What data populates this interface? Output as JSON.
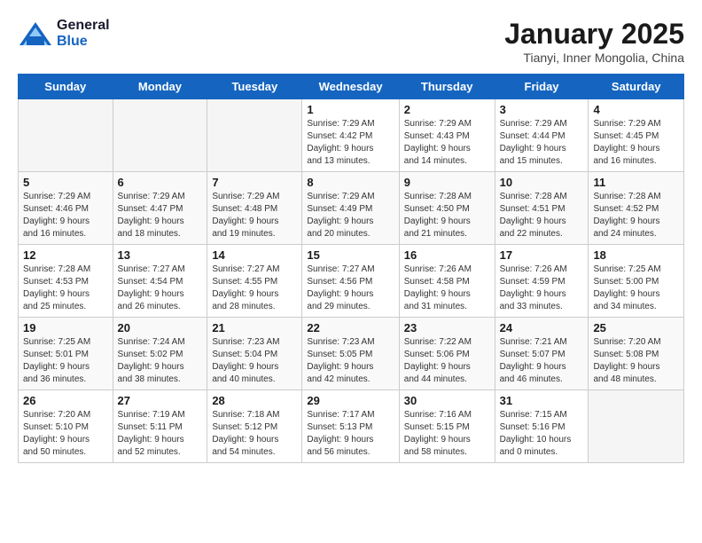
{
  "logo": {
    "general": "General",
    "blue": "Blue"
  },
  "title": "January 2025",
  "location": "Tianyi, Inner Mongolia, China",
  "days_header": [
    "Sunday",
    "Monday",
    "Tuesday",
    "Wednesday",
    "Thursday",
    "Friday",
    "Saturday"
  ],
  "weeks": [
    [
      {
        "day": "",
        "info": ""
      },
      {
        "day": "",
        "info": ""
      },
      {
        "day": "",
        "info": ""
      },
      {
        "day": "1",
        "info": "Sunrise: 7:29 AM\nSunset: 4:42 PM\nDaylight: 9 hours\nand 13 minutes."
      },
      {
        "day": "2",
        "info": "Sunrise: 7:29 AM\nSunset: 4:43 PM\nDaylight: 9 hours\nand 14 minutes."
      },
      {
        "day": "3",
        "info": "Sunrise: 7:29 AM\nSunset: 4:44 PM\nDaylight: 9 hours\nand 15 minutes."
      },
      {
        "day": "4",
        "info": "Sunrise: 7:29 AM\nSunset: 4:45 PM\nDaylight: 9 hours\nand 16 minutes."
      }
    ],
    [
      {
        "day": "5",
        "info": "Sunrise: 7:29 AM\nSunset: 4:46 PM\nDaylight: 9 hours\nand 16 minutes."
      },
      {
        "day": "6",
        "info": "Sunrise: 7:29 AM\nSunset: 4:47 PM\nDaylight: 9 hours\nand 18 minutes."
      },
      {
        "day": "7",
        "info": "Sunrise: 7:29 AM\nSunset: 4:48 PM\nDaylight: 9 hours\nand 19 minutes."
      },
      {
        "day": "8",
        "info": "Sunrise: 7:29 AM\nSunset: 4:49 PM\nDaylight: 9 hours\nand 20 minutes."
      },
      {
        "day": "9",
        "info": "Sunrise: 7:28 AM\nSunset: 4:50 PM\nDaylight: 9 hours\nand 21 minutes."
      },
      {
        "day": "10",
        "info": "Sunrise: 7:28 AM\nSunset: 4:51 PM\nDaylight: 9 hours\nand 22 minutes."
      },
      {
        "day": "11",
        "info": "Sunrise: 7:28 AM\nSunset: 4:52 PM\nDaylight: 9 hours\nand 24 minutes."
      }
    ],
    [
      {
        "day": "12",
        "info": "Sunrise: 7:28 AM\nSunset: 4:53 PM\nDaylight: 9 hours\nand 25 minutes."
      },
      {
        "day": "13",
        "info": "Sunrise: 7:27 AM\nSunset: 4:54 PM\nDaylight: 9 hours\nand 26 minutes."
      },
      {
        "day": "14",
        "info": "Sunrise: 7:27 AM\nSunset: 4:55 PM\nDaylight: 9 hours\nand 28 minutes."
      },
      {
        "day": "15",
        "info": "Sunrise: 7:27 AM\nSunset: 4:56 PM\nDaylight: 9 hours\nand 29 minutes."
      },
      {
        "day": "16",
        "info": "Sunrise: 7:26 AM\nSunset: 4:58 PM\nDaylight: 9 hours\nand 31 minutes."
      },
      {
        "day": "17",
        "info": "Sunrise: 7:26 AM\nSunset: 4:59 PM\nDaylight: 9 hours\nand 33 minutes."
      },
      {
        "day": "18",
        "info": "Sunrise: 7:25 AM\nSunset: 5:00 PM\nDaylight: 9 hours\nand 34 minutes."
      }
    ],
    [
      {
        "day": "19",
        "info": "Sunrise: 7:25 AM\nSunset: 5:01 PM\nDaylight: 9 hours\nand 36 minutes."
      },
      {
        "day": "20",
        "info": "Sunrise: 7:24 AM\nSunset: 5:02 PM\nDaylight: 9 hours\nand 38 minutes."
      },
      {
        "day": "21",
        "info": "Sunrise: 7:23 AM\nSunset: 5:04 PM\nDaylight: 9 hours\nand 40 minutes."
      },
      {
        "day": "22",
        "info": "Sunrise: 7:23 AM\nSunset: 5:05 PM\nDaylight: 9 hours\nand 42 minutes."
      },
      {
        "day": "23",
        "info": "Sunrise: 7:22 AM\nSunset: 5:06 PM\nDaylight: 9 hours\nand 44 minutes."
      },
      {
        "day": "24",
        "info": "Sunrise: 7:21 AM\nSunset: 5:07 PM\nDaylight: 9 hours\nand 46 minutes."
      },
      {
        "day": "25",
        "info": "Sunrise: 7:20 AM\nSunset: 5:08 PM\nDaylight: 9 hours\nand 48 minutes."
      }
    ],
    [
      {
        "day": "26",
        "info": "Sunrise: 7:20 AM\nSunset: 5:10 PM\nDaylight: 9 hours\nand 50 minutes."
      },
      {
        "day": "27",
        "info": "Sunrise: 7:19 AM\nSunset: 5:11 PM\nDaylight: 9 hours\nand 52 minutes."
      },
      {
        "day": "28",
        "info": "Sunrise: 7:18 AM\nSunset: 5:12 PM\nDaylight: 9 hours\nand 54 minutes."
      },
      {
        "day": "29",
        "info": "Sunrise: 7:17 AM\nSunset: 5:13 PM\nDaylight: 9 hours\nand 56 minutes."
      },
      {
        "day": "30",
        "info": "Sunrise: 7:16 AM\nSunset: 5:15 PM\nDaylight: 9 hours\nand 58 minutes."
      },
      {
        "day": "31",
        "info": "Sunrise: 7:15 AM\nSunset: 5:16 PM\nDaylight: 10 hours\nand 0 minutes."
      },
      {
        "day": "",
        "info": ""
      }
    ]
  ]
}
